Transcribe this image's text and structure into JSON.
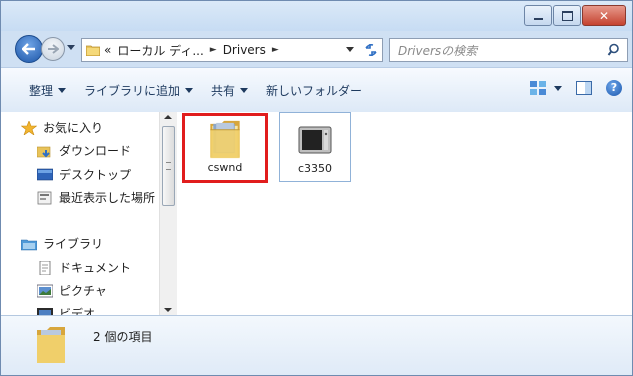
{
  "window": {
    "caption_buttons": [
      "minimize",
      "maximize",
      "close"
    ]
  },
  "address": {
    "breadcrumb_prefix": "«",
    "crumbs": [
      "ローカル ディ...",
      "Drivers"
    ],
    "search_placeholder": "Driversの検索"
  },
  "toolbar": {
    "organize": "整理",
    "add_to_library": "ライブラリに追加",
    "share": "共有",
    "new_folder": "新しいフォルダー"
  },
  "nav": {
    "favorites": "お気に入り",
    "downloads": "ダウンロード",
    "desktop": "デスクトップ",
    "recent": "最近表示した場所",
    "libraries": "ライブラリ",
    "documents": "ドキュメント",
    "pictures": "ピクチャ",
    "videos": "ビデオ"
  },
  "files": [
    {
      "name": "cswnd",
      "icon": "folder-icon",
      "highlighted": true
    },
    {
      "name": "c3350",
      "icon": "device-icon",
      "highlighted": false
    }
  ],
  "status": {
    "count_text": "2 個の項目"
  },
  "colors": {
    "highlight_border": "#e11d1d",
    "close_button": "#c54330",
    "accent_blue": "#1d56a8"
  }
}
